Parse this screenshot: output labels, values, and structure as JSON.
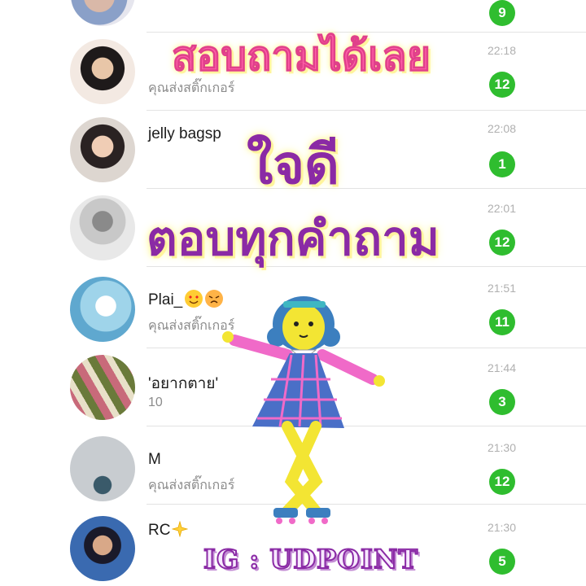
{
  "chats": [
    {
      "name": "",
      "message": "",
      "time": "",
      "badge": "9"
    },
    {
      "name": "",
      "message": "คุณส่งสติ๊กเกอร์",
      "time": "22:18",
      "badge": "12"
    },
    {
      "name": "jelly bagsp",
      "message": "",
      "time": "22:08",
      "badge": "1"
    },
    {
      "name": "",
      "message": "",
      "time": "22:01",
      "badge": "12"
    },
    {
      "name": "Plai_",
      "message": "คุณส่งสติ๊กเกอร์",
      "time": "21:51",
      "badge": "11"
    },
    {
      "name": "'อยากตาย'",
      "message": "10",
      "time": "21:44",
      "badge": "3"
    },
    {
      "name": "M",
      "message": "คุณส่งสติ๊กเกอร์",
      "time": "21:30",
      "badge": "12"
    },
    {
      "name": "RC",
      "message": "",
      "time": "21:30",
      "badge": "5"
    }
  ],
  "overlay": {
    "line1": "สอบถามได้เลย",
    "line2": "ใจดี",
    "line3": "ตอบทุกคำถาม",
    "ig": "IG : UDPOINT"
  },
  "colors": {
    "badge": "#2fbd2f",
    "line1": "#ff5fa8",
    "line2": "#8a2aa5",
    "line3": "#8a2aa5",
    "text_glow": "#fff7a0"
  },
  "icons": [
    "heart-eyes-emoji-icon",
    "angry-emoji-icon",
    "sparkle-star-icon"
  ]
}
